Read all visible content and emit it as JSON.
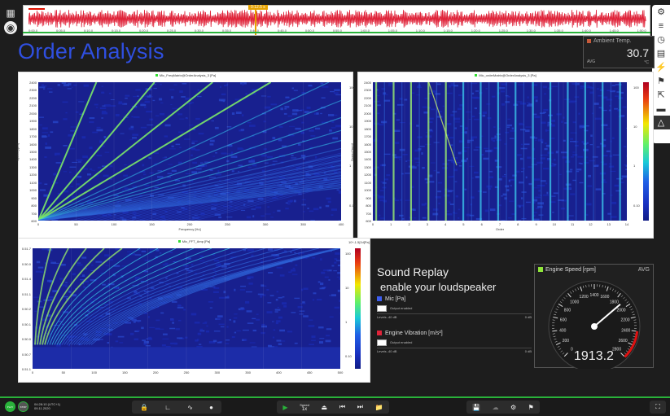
{
  "page_title": "Order Analysis",
  "overview": {
    "cursor_label": "0:12.5 s",
    "ticks": [
      "0:00.0",
      "0:05.0",
      "0:10.0",
      "0:15.0",
      "0:20.0",
      "0:25.0",
      "0:30.0",
      "0:35.0",
      "0:40.0",
      "0:45.0",
      "0:50.0",
      "0:55.0",
      "1:00.0",
      "1:05.0",
      "1:10.0",
      "1:15.0",
      "1:20.0",
      "1:25.0",
      "1:30.0",
      "1:35.0",
      "1:40.0",
      "1:45.0",
      "1:50.0"
    ],
    "wave_color": "#e0243a"
  },
  "left_toolbar": {
    "icons": [
      "layers-icon",
      "disk-icon"
    ]
  },
  "right_toolbar": {
    "icons": [
      "gear-icon",
      "list-icon",
      "clock-icon",
      "report-icon",
      "lightning-icon",
      "flag-icon",
      "export-icon",
      "car-icon",
      "triangle-icon"
    ]
  },
  "ambient": {
    "label": "Ambient Temp.",
    "value": "30.7",
    "avg": "AVG",
    "unit": "°C"
  },
  "panels": {
    "p1": {
      "title": "Mic_FreqMatrix@OrderAnalysis_3 [Pa]",
      "ylabel": "Speed [rpm]",
      "xlabel": "Frequency [Hz]",
      "xticks": [
        "0",
        "50",
        "100",
        "150",
        "200",
        "250",
        "300",
        "350",
        "400"
      ],
      "yticks": [
        "2400",
        "2300",
        "2200",
        "2100",
        "2000",
        "1900",
        "1800",
        "1700",
        "1600",
        "1500",
        "1400",
        "1300",
        "1200",
        "1100",
        "1000",
        "900",
        "800",
        "700",
        "600"
      ],
      "cbar": [
        "100",
        "10",
        "1",
        "0.10"
      ]
    },
    "p2": {
      "title": "Mic_orderMatrix@OrderAnalysis_3 [Pa]",
      "ylabel": "Speed [rpm]",
      "xlabel": "Order",
      "xticks": [
        "0",
        "1",
        "2",
        "3",
        "4",
        "5",
        "6",
        "7",
        "8",
        "9",
        "10",
        "11",
        "12",
        "13",
        "14"
      ],
      "yticks": [
        "2400",
        "2300",
        "2200",
        "2100",
        "2000",
        "1900",
        "1800",
        "1700",
        "1600",
        "1500",
        "1400",
        "1300",
        "1200",
        "1100",
        "1000",
        "900",
        "800",
        "700",
        "600"
      ],
      "cbar": [
        "100",
        "10",
        "1",
        "0.10"
      ]
    },
    "p3": {
      "title": "Mic_FFT_Amp [Pa]",
      "xlabel": "",
      "xticks": [
        "0",
        "50",
        "100",
        "150",
        "200",
        "250",
        "300",
        "350",
        "400",
        "450",
        "500"
      ],
      "yticks": [
        "0.51.7",
        "0.50.0",
        "0.51.4",
        "0.51.1",
        "0.50.2",
        "0.50.1",
        "0.50.0",
        "0.50.7",
        "0.51.1"
      ],
      "cbar": [
        "100",
        "10",
        "1",
        "0.10"
      ],
      "cbar_top": "10^-1.5|2d[Pa]"
    }
  },
  "sound_replay": {
    "heading1": "Sound Replay",
    "heading2": "enable your loudspeaker",
    "channels": [
      {
        "name": "Mic [Pa]",
        "color": "#3d5ef0",
        "output": "Output enabled",
        "level_left": "Levels -40 dB",
        "level_right": "0 dB"
      },
      {
        "name": "Engine Vibration [m/s²]",
        "color": "#e0243a",
        "output": "Output enabled",
        "level_left": "Levels -40 dB",
        "level_right": "0 dB"
      }
    ]
  },
  "gauge": {
    "label": "Engine Speed [rpm]",
    "avg": "AVG",
    "value": "1913.2",
    "rpm": 1913.2,
    "ticks": [
      "0",
      "200",
      "400",
      "600",
      "800",
      "1000",
      "1200",
      "1400",
      "1600",
      "1800",
      "2000",
      "2200",
      "2400",
      "2600",
      "2800"
    ]
  },
  "bottom": {
    "play_label": "PLAY",
    "stop_label": "STOP",
    "datetime_line1": "04:28:10 (UTC+1)",
    "datetime_line2": "09.11.2020",
    "speed_label": "Speed",
    "speed_value": "1x"
  }
}
